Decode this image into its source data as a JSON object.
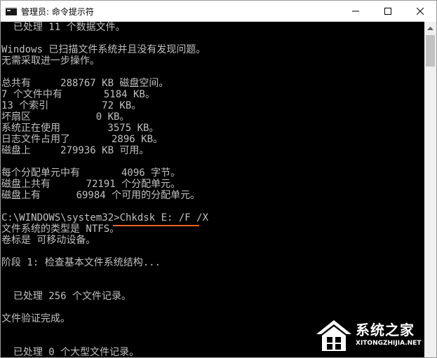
{
  "window": {
    "title": "管理员: 命令提示符",
    "icon": "console-icon",
    "controls": [
      "minimize-icon",
      "maximize-icon",
      "close-icon"
    ]
  },
  "console": {
    "text_color": "#c0c0c0",
    "background": "#000000",
    "highlight_color": "#e8641e",
    "lines": [
      "  已处理 11 个数据文件。",
      "",
      "Windows 已扫描文件系统并且没有发现问题。",
      "无需采取进一步操作。",
      "",
      "总共有     288767 KB 磁盘空间。",
      "7 个文件中有       5184 KB。",
      "13 个索引         72 KB。",
      "坏扇区           0 KB。",
      "系统正在使用        3575 KB。",
      "日志文件占用了       2896 KB。",
      "磁盘上     279936 KB 可用。",
      "",
      "每个分配单元中有       4096 字节。",
      "磁盘上共有      72191 个分配单元。",
      "磁盘上有      69984 个可用的分配单元。",
      "",
      "C:\\WINDOWS\\system32>Chkdsk E: /F /X",
      "文件系统的类型是 NTFS。",
      "卷标是 可移动设备。",
      "",
      "阶段 1: 检查基本文件系统结构...",
      "",
      "",
      "  已处理 256 个文件记录。",
      "",
      "文件验证完成。",
      "",
      "",
      "  已处理 0 个大型文件记录。"
    ]
  },
  "watermark": {
    "name": "系统之家",
    "url": "XITONGZHIJIA.NET"
  }
}
